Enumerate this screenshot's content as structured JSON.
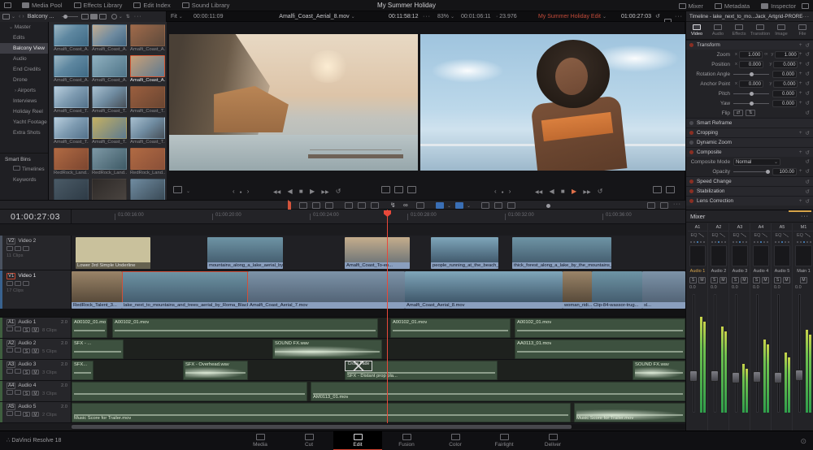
{
  "app": {
    "title": "My Summer Holiday",
    "version": "DaVinci Resolve 18"
  },
  "icons": {
    "chevron_down": "⌄",
    "chevron_right": "›",
    "ellipsis": "···",
    "prev": "◀◀",
    "back": "◀",
    "stop": "■",
    "play": "▶",
    "next": "▶▶",
    "loop": "↺",
    "plus": "+",
    "reset": "↺",
    "link": "∞",
    "flip_h": "⇄",
    "flip_v": "⇅",
    "jog_left": "‹",
    "jog_dot": "●",
    "jog_right": "›",
    "sort": "⇅",
    "logo": "∴",
    "gear": "⊙"
  },
  "topbar": {
    "media_pool": "Media Pool",
    "effects_library": "Effects Library",
    "edit_index": "Edit Index",
    "sound_library": "Sound Library",
    "mixer": "Mixer",
    "metadata": "Metadata",
    "inspector": "Inspector"
  },
  "media_pool": {
    "bin_label": "Balcony ...",
    "bins": [
      "Master",
      "Edits",
      "Balcony View",
      "Audio",
      "End Credits",
      "Drone",
      "Airports",
      "Interviews",
      "Holiday Reel",
      "Yacht Footage",
      "Extra Shots"
    ],
    "smart_bins_title": "Smart Bins",
    "smart_bins": [
      "Timelines",
      "Keywords"
    ],
    "clip_labels": [
      "Amalfi_Coast_A...",
      "Amalfi_Coast_A...",
      "Amalfi_Coast_A...",
      "Amalfi_Coast_A...",
      "Amalfi_Coast_A...",
      "Amalfi_Coast_A...",
      "Amalfi_Coast_T...",
      "Amalfi_Coast_T...",
      "Amalfi_Coast_T...",
      "Amalfi_Coast_T...",
      "Amalfi_Coast_T...",
      "Amalfi_Coast_T...",
      "RedRock_Land...",
      "RedRock_Land...",
      "RedRock_Land..."
    ]
  },
  "source_viewer": {
    "fit": "Fit",
    "tc_in": "00:00:11:09",
    "clip_name": "Amalfi_Coast_Aerial_8.mov",
    "duration": "00:11:58:12"
  },
  "timeline_viewer": {
    "zoom": "83%",
    "tc_left": "00:01:06:11",
    "fps": "· 23.976",
    "title": "My Summer Holiday Edit",
    "timecode": "01:00:27:03"
  },
  "inspector": {
    "header": "Timeline - lake_next_to_mo...Jack_Artgrid-PRORES422.mov",
    "tabs": [
      "Video",
      "Audio",
      "Effects",
      "Transition",
      "Image",
      "File"
    ],
    "axis_x": "x",
    "axis_y": "y",
    "transform": {
      "title": "Transform",
      "zoom_label": "Zoom",
      "zoom_x": "1.000",
      "zoom_y": "1.000",
      "position_label": "Position",
      "pos_x": "0.000",
      "pos_y": "0.000",
      "rotation_label": "Rotation Angle",
      "rotation": "0.000",
      "anchor_label": "Anchor Point",
      "anchor_x": "0.000",
      "anchor_y": "0.000",
      "pitch_label": "Pitch",
      "pitch": "0.000",
      "yaw_label": "Yaw",
      "yaw": "0.000",
      "flip_label": "Flip"
    },
    "sections": {
      "smart_reframe": "Smart Reframe",
      "cropping": "Cropping",
      "dynamic_zoom": "Dynamic Zoom",
      "composite": "Composite",
      "speed_change": "Speed Change",
      "stabilization": "Stabilization",
      "lens_correction": "Lens Correction"
    },
    "composite": {
      "mode_label": "Composite Mode",
      "mode_value": "Normal",
      "opacity_label": "Opacity",
      "opacity_value": "100.00"
    }
  },
  "timeline": {
    "master_timecode": "01:00:27:03",
    "ruler": [
      "01:00:16:00",
      "01:00:20:00",
      "01:00:24:00",
      "01:00:28:00",
      "01:00:32:00",
      "01:00:36:00"
    ],
    "tracks": [
      {
        "id": "V2",
        "name": "Video 2",
        "count": "11 Clips"
      },
      {
        "id": "V1",
        "name": "Video 1",
        "count": "17 Clips"
      },
      {
        "id": "A1",
        "name": "Audio 1",
        "ch": "2.0",
        "count": "8 Clips"
      },
      {
        "id": "A2",
        "name": "Audio 2",
        "ch": "2.0",
        "count": "5 Clips"
      },
      {
        "id": "A3",
        "name": "Audio 3",
        "ch": "2.0",
        "count": "3 Clips"
      },
      {
        "id": "A4",
        "name": "Audio 4",
        "ch": "2.0",
        "count": "3 Clips"
      },
      {
        "id": "A5",
        "name": "Audio 5",
        "ch": "2.0",
        "count": "2 Clips"
      }
    ],
    "v2_clips": [
      "Lower 3rd Simple Underline",
      "mountains_along_a_lake_aerial_by_Roma...",
      "Amalfi_Coast_To-en...",
      "people_running_at_the_beach_in_brig...",
      "thick_forest_along_a_lake_by_the_mountains_aerial_by_..."
    ],
    "v1_clips": [
      "RedRock_Talent_3...",
      "lake_next_to_mountains_and_trees_aerial_by_Roma_Black_Artgrid-PRORES4...",
      "Amalfi_Coast_Aerial_7.mov",
      "Amalfi_Coast_Aerial_8.mov",
      "woman_ridi...",
      "Clip-84-wassor-trug...",
      "sl..."
    ],
    "a1_clips": [
      "A00102_01.mov",
      "A00102_01.mov",
      "A00102_01.mov",
      "A00102_01.mov"
    ],
    "a2_clips": [
      "SFX - ...",
      "SOUND FX.wav",
      "AA0113_01.mov"
    ],
    "a3_clips": [
      "SFX...",
      "SFX - Overhead.wav",
      "SFX - Distant prop pla...",
      "SOUND FX.wav"
    ],
    "a4_clips": [
      "",
      "AM0113_01.mov"
    ],
    "a5_clips": [
      "Music Score for Trailer.mov",
      "Music Score for Trailer.mov"
    ],
    "crossfade": "Cross Fade"
  },
  "mixer": {
    "title": "Mixer",
    "solo": "S",
    "mute": "M",
    "eq": "EQ",
    "level": "0.0",
    "channels": [
      {
        "id": "A1",
        "name": "Audio 1"
      },
      {
        "id": "A2",
        "name": "Audio 2"
      },
      {
        "id": "A3",
        "name": "Audio 3"
      },
      {
        "id": "A4",
        "name": "Audio 4"
      },
      {
        "id": "A5",
        "name": "Audio 5"
      },
      {
        "id": "M1",
        "name": "Main 1"
      }
    ]
  },
  "pages": [
    "Media",
    "Cut",
    "Edit",
    "Fusion",
    "Color",
    "Fairlight",
    "Deliver"
  ]
}
